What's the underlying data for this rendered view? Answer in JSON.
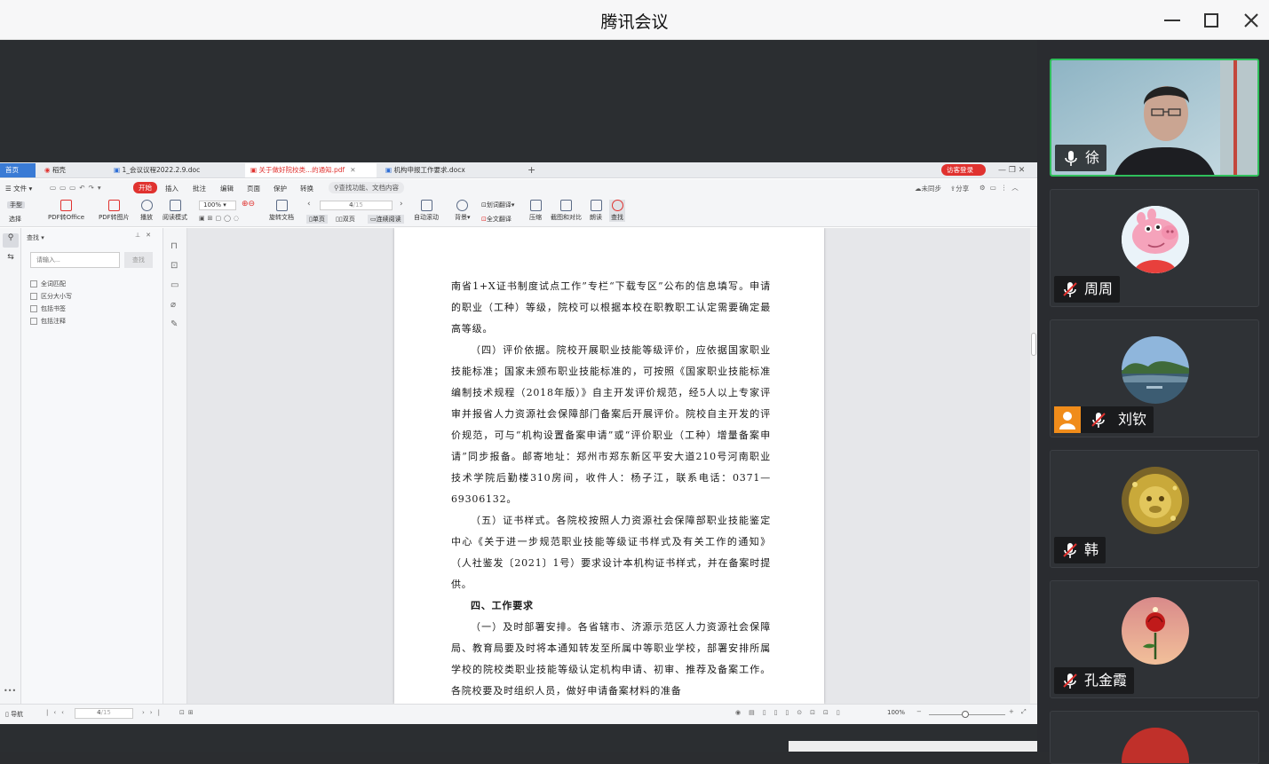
{
  "window": {
    "title": "腾讯会议"
  },
  "app": {
    "tabs": [
      {
        "label": "首页"
      },
      {
        "label": "稻壳"
      },
      {
        "label": "1_会议议程2022.2.9.doc"
      },
      {
        "label": "关于做好院校类...的通知.pdf"
      },
      {
        "label": "机构申报工作要求.docx"
      }
    ],
    "login_label": "访客登录",
    "menu": [
      "文件",
      "开始",
      "插入",
      "批注",
      "编辑",
      "页面",
      "保护",
      "转换"
    ],
    "search_menu": "查找功能、文档内容",
    "menu_right": [
      "未同步",
      "分享"
    ],
    "toolbar": {
      "hand": "手型",
      "select": "选择",
      "pdf_to_office": "PDF转Office",
      "pdf_to_image": "PDF转图片",
      "play": "播放",
      "read_mode": "阅读模式",
      "zoom": "100%",
      "rotate": "旋转文档",
      "page_value": "4",
      "page_total": "/15",
      "single": "单页",
      "double": "双页",
      "continuous": "连续阅读",
      "auto_scroll": "自动滚动",
      "background": "背景",
      "translate": "划词翻译",
      "full_translate": "全文翻译",
      "compress": "压缩",
      "compare": "截图和对比",
      "read_aloud": "朗读",
      "find": "查找"
    },
    "find_panel": {
      "title": "查找",
      "placeholder": "请输入...",
      "button": "查找",
      "options": [
        "全词匹配",
        "区分大小写",
        "包括书签",
        "包括注释"
      ]
    },
    "document": {
      "lines": [
        {
          "type": "c",
          "text": "南省1+X证书制度试点工作”专栏“下载专区”公布的信息填写。申请的职业（工种）等级，院校可以根据本校在职教职工认定需要确定最高等级。"
        },
        {
          "type": "p",
          "text": "（四）评价依据。院校开展职业技能等级评价，应依据国家职业技能标准；国家未颁布职业技能标准的，可按照《国家职业技能标准编制技术规程（2018年版）》自主开发评价规范，经5人以上专家评审并报省人力资源社会保障部门备案后开展评价。院校自主开发的评价规范，可与“机构设置备案申请”或“评价职业（工种）增量备案申请”同步报备。邮寄地址：郑州市郑东新区平安大道210号河南职业技术学院后勤楼310房间，收件人：杨子江，联系电话：0371—69306132。"
        },
        {
          "type": "p",
          "text": "（五）证书样式。各院校按照人力资源社会保障部职业技能鉴定中心《关于进一步规范职业技能等级证书样式及有关工作的通知》（人社鉴发〔2021〕1号）要求设计本机构证书样式，并在备案时提供。"
        },
        {
          "type": "h",
          "text": "四、工作要求"
        },
        {
          "type": "p",
          "text": "（一）及时部署安排。各省辖市、济源示范区人力资源社会保障局、教育局要及时将本通知转发至所属中等职业学校，部署安排所属学校的院校类职业技能等级认定机构申请、初审、推荐及备案工作。各院校要及时组织人员，做好申请备案材料的准备"
        }
      ]
    },
    "status": {
      "nav_label": "导航",
      "page_value": "4",
      "page_total": "/15",
      "zoom": "100%"
    }
  },
  "participants": [
    {
      "name": "徐",
      "mic": "on",
      "avatar": "camera-video",
      "active": true
    },
    {
      "name": "周周",
      "mic": "off",
      "avatar": "cartoon-pig"
    },
    {
      "name": "刘钦",
      "mic": "off",
      "avatar": "lake-landscape",
      "badge": "host-icon"
    },
    {
      "name": "韩",
      "mic": "off",
      "avatar": "golden-monkey"
    },
    {
      "name": "孔金霞",
      "mic": "off",
      "avatar": "red-rose"
    }
  ],
  "colors": {
    "accent_red": "#e0322f",
    "active_border": "#2fbf5b",
    "host_orange": "#f08c1a"
  }
}
